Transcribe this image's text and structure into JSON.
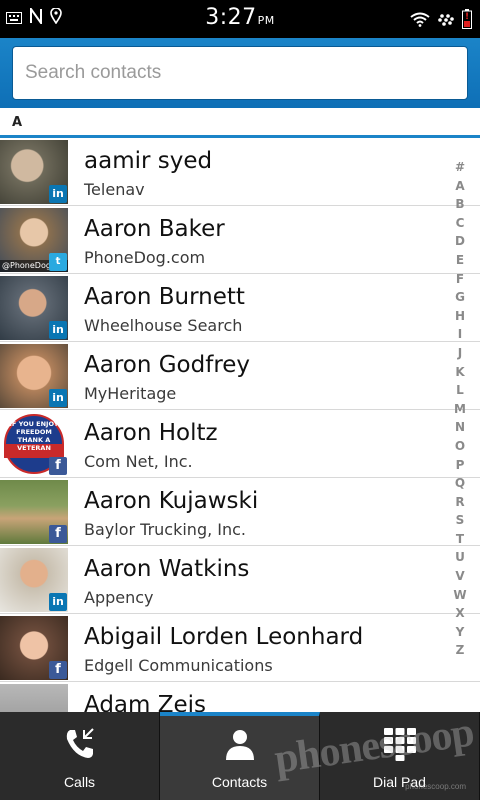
{
  "status_bar": {
    "time": "3:27",
    "ampm": "PM"
  },
  "search": {
    "placeholder": "Search contacts"
  },
  "section": {
    "letter": "A"
  },
  "contacts": [
    {
      "name": "aamir syed",
      "subtitle": "Telenav",
      "badge": "linkedin",
      "badge_text": "in",
      "avatar_color": "#6e6a5a"
    },
    {
      "name": "Aaron Baker",
      "subtitle": "PhoneDog.com",
      "badge": "twitter",
      "badge_text": "t",
      "avatar_color": "#7a6a50",
      "avatar_caption": "@PhoneDog"
    },
    {
      "name": "Aaron Burnett",
      "subtitle": "Wheelhouse Search",
      "badge": "linkedin",
      "badge_text": "in",
      "avatar_color": "#5d6670"
    },
    {
      "name": "Aaron Godfrey",
      "subtitle": "MyHeritage",
      "badge": "linkedin",
      "badge_text": "in",
      "avatar_color": "#b0805a"
    },
    {
      "name": "Aaron Holtz",
      "subtitle": "Com Net, Inc.",
      "badge": "facebook",
      "badge_text": "f",
      "avatar_color": "#1d3c8c",
      "avatar_caption": "IF YOU ENJOY FREEDOM THANK A VETERAN"
    },
    {
      "name": "Aaron Kujawski",
      "subtitle": "Baylor Trucking, Inc.",
      "badge": "facebook",
      "badge_text": "f",
      "avatar_color": "#5f7a3c"
    },
    {
      "name": "Aaron Watkins",
      "subtitle": "Appency",
      "badge": "linkedin",
      "badge_text": "in",
      "avatar_color": "#c9c0b0"
    },
    {
      "name": "Abigail Lorden Leonhard",
      "subtitle": "Edgell Communications",
      "badge": "facebook",
      "badge_text": "f",
      "avatar_color": "#6a4a3a"
    },
    {
      "name": "Adam Zeis",
      "subtitle": "",
      "badge": "",
      "badge_text": "",
      "avatar_color": "#9a9a9a"
    }
  ],
  "alpha_index": [
    "#",
    "A",
    "B",
    "C",
    "D",
    "E",
    "F",
    "G",
    "H",
    "I",
    "J",
    "K",
    "L",
    "M",
    "N",
    "O",
    "P",
    "Q",
    "R",
    "S",
    "T",
    "U",
    "V",
    "W",
    "X",
    "Y",
    "Z"
  ],
  "tabs": [
    {
      "label": "Calls",
      "icon": "phone-icon"
    },
    {
      "label": "Contacts",
      "icon": "person-icon",
      "active": true
    },
    {
      "label": "Dial Pad",
      "icon": "dialpad-icon"
    }
  ],
  "watermark": {
    "text": "phonescoop",
    "sub": "phonescoop.com"
  },
  "colors": {
    "accent": "#1b84c8",
    "linkedin": "#0a76b3",
    "twitter": "#2aa9e0",
    "facebook": "#3b5998"
  }
}
